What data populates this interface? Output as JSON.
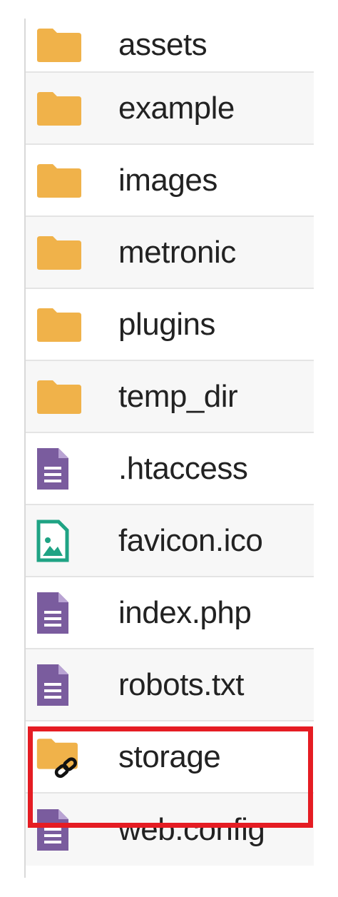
{
  "file_list": {
    "items": [
      {
        "name": "assets",
        "type": "folder",
        "icon": "folder-icon"
      },
      {
        "name": "example",
        "type": "folder",
        "icon": "folder-icon"
      },
      {
        "name": "images",
        "type": "folder",
        "icon": "folder-icon"
      },
      {
        "name": "metronic",
        "type": "folder",
        "icon": "folder-icon"
      },
      {
        "name": "plugins",
        "type": "folder",
        "icon": "folder-icon"
      },
      {
        "name": "temp_dir",
        "type": "folder",
        "icon": "folder-icon"
      },
      {
        "name": ".htaccess",
        "type": "file",
        "icon": "text-file-icon"
      },
      {
        "name": "favicon.ico",
        "type": "image",
        "icon": "image-file-icon"
      },
      {
        "name": "index.php",
        "type": "file",
        "icon": "text-file-icon"
      },
      {
        "name": "robots.txt",
        "type": "file",
        "icon": "text-file-icon"
      },
      {
        "name": "storage",
        "type": "symlink-folder",
        "icon": "linked-folder-icon",
        "highlighted": true
      },
      {
        "name": "web.config",
        "type": "file",
        "icon": "text-file-icon"
      }
    ]
  },
  "colors": {
    "folder": "#F0B24A",
    "text_file": "#7A5C9E",
    "image_file": "#1FA384",
    "highlight": "#E51C23"
  }
}
